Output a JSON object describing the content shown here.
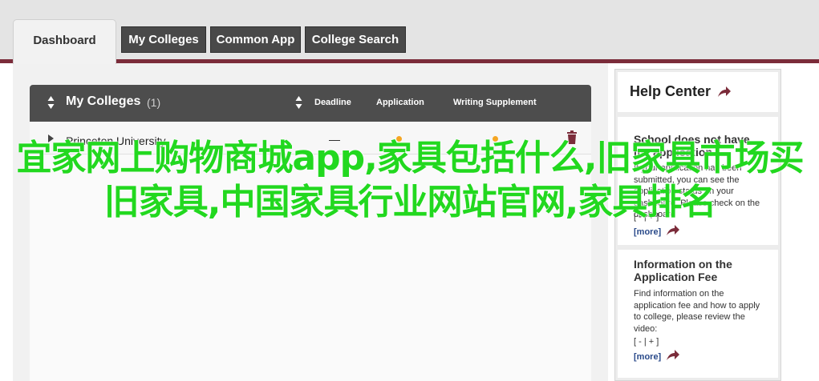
{
  "tabs": {
    "active": "Dashboard",
    "items": [
      "My Colleges",
      "Common App",
      "College Search"
    ]
  },
  "table": {
    "title": "My Colleges",
    "count": "(1)",
    "columns": [
      "Deadline",
      "Application",
      "Writing Supplement"
    ],
    "rows": [
      {
        "name": "Princeton University",
        "deadline": "—"
      }
    ]
  },
  "help": {
    "title": "Help Center",
    "cards": [
      {
        "heading": "School does not have my application",
        "body": "If your application has been submitted, you can see the application status on your dashboard. Please check on the dashboard",
        "controls": "[ - | + ]",
        "more": "[more]"
      },
      {
        "heading": "Information on the Application Fee",
        "body": "Find information on the application fee and how to apply to college, please review the video:",
        "controls": "[ - | + ]",
        "more": "[more]"
      }
    ]
  },
  "overlay": {
    "text": "宜家网上购物商城app,家具包括什么,旧家具市场买旧家具,中国家具行业网站官网,家具排名"
  },
  "colors": {
    "accent": "#7b2c3a",
    "tab_dark": "#494949",
    "overlay_green": "#22d81f",
    "status_dot": "#f5a623"
  }
}
